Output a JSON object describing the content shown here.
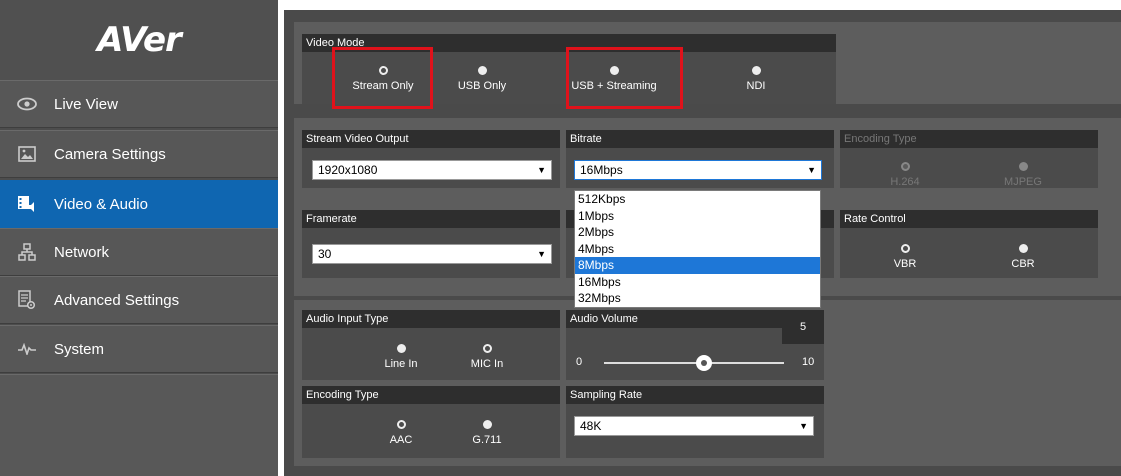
{
  "logo": "AVer",
  "nav": [
    {
      "label": "Live View",
      "icon": "eye-icon"
    },
    {
      "label": "Camera Settings",
      "icon": "image-icon"
    },
    {
      "label": "Video & Audio",
      "icon": "video-audio-icon"
    },
    {
      "label": "Network",
      "icon": "network-icon"
    },
    {
      "label": "Advanced Settings",
      "icon": "settings-doc-icon"
    },
    {
      "label": "System",
      "icon": "pulse-icon"
    }
  ],
  "video_mode": {
    "title": "Video Mode",
    "options": [
      "Stream Only",
      "USB Only",
      "USB + Streaming",
      "NDI"
    ],
    "selected": "Stream Only"
  },
  "stream_output": {
    "title": "Stream Video Output",
    "value": "1920x1080"
  },
  "bitrate": {
    "title": "Bitrate",
    "value": "16Mbps",
    "options": [
      "512Kbps",
      "1Mbps",
      "2Mbps",
      "4Mbps",
      "8Mbps",
      "16Mbps",
      "32Mbps"
    ],
    "highlighted": "8Mbps"
  },
  "encoding_type_video": {
    "title": "Encoding Type",
    "options": [
      "H.264",
      "MJPEG"
    ],
    "selected": "H.264",
    "disabled": true
  },
  "framerate": {
    "title": "Framerate",
    "value": "30"
  },
  "rate_control": {
    "title": "Rate Control",
    "options": [
      "VBR",
      "CBR"
    ],
    "selected": "VBR"
  },
  "audio_input": {
    "title": "Audio Input Type",
    "options": [
      "Line In",
      "MIC In"
    ],
    "selected": "MIC In"
  },
  "audio_volume": {
    "title": "Audio Volume",
    "value": "5",
    "min": "0",
    "max": "10",
    "level": 0.5
  },
  "encoding_type_audio": {
    "title": "Encoding Type",
    "options": [
      "AAC",
      "G.711"
    ],
    "selected": "AAC"
  },
  "sampling_rate": {
    "title": "Sampling Rate",
    "value": "48K"
  },
  "colors": {
    "active_nav": "#0f66b1",
    "highlight_box": "#e0121b",
    "dropdown_highlight": "#1e77d7"
  }
}
